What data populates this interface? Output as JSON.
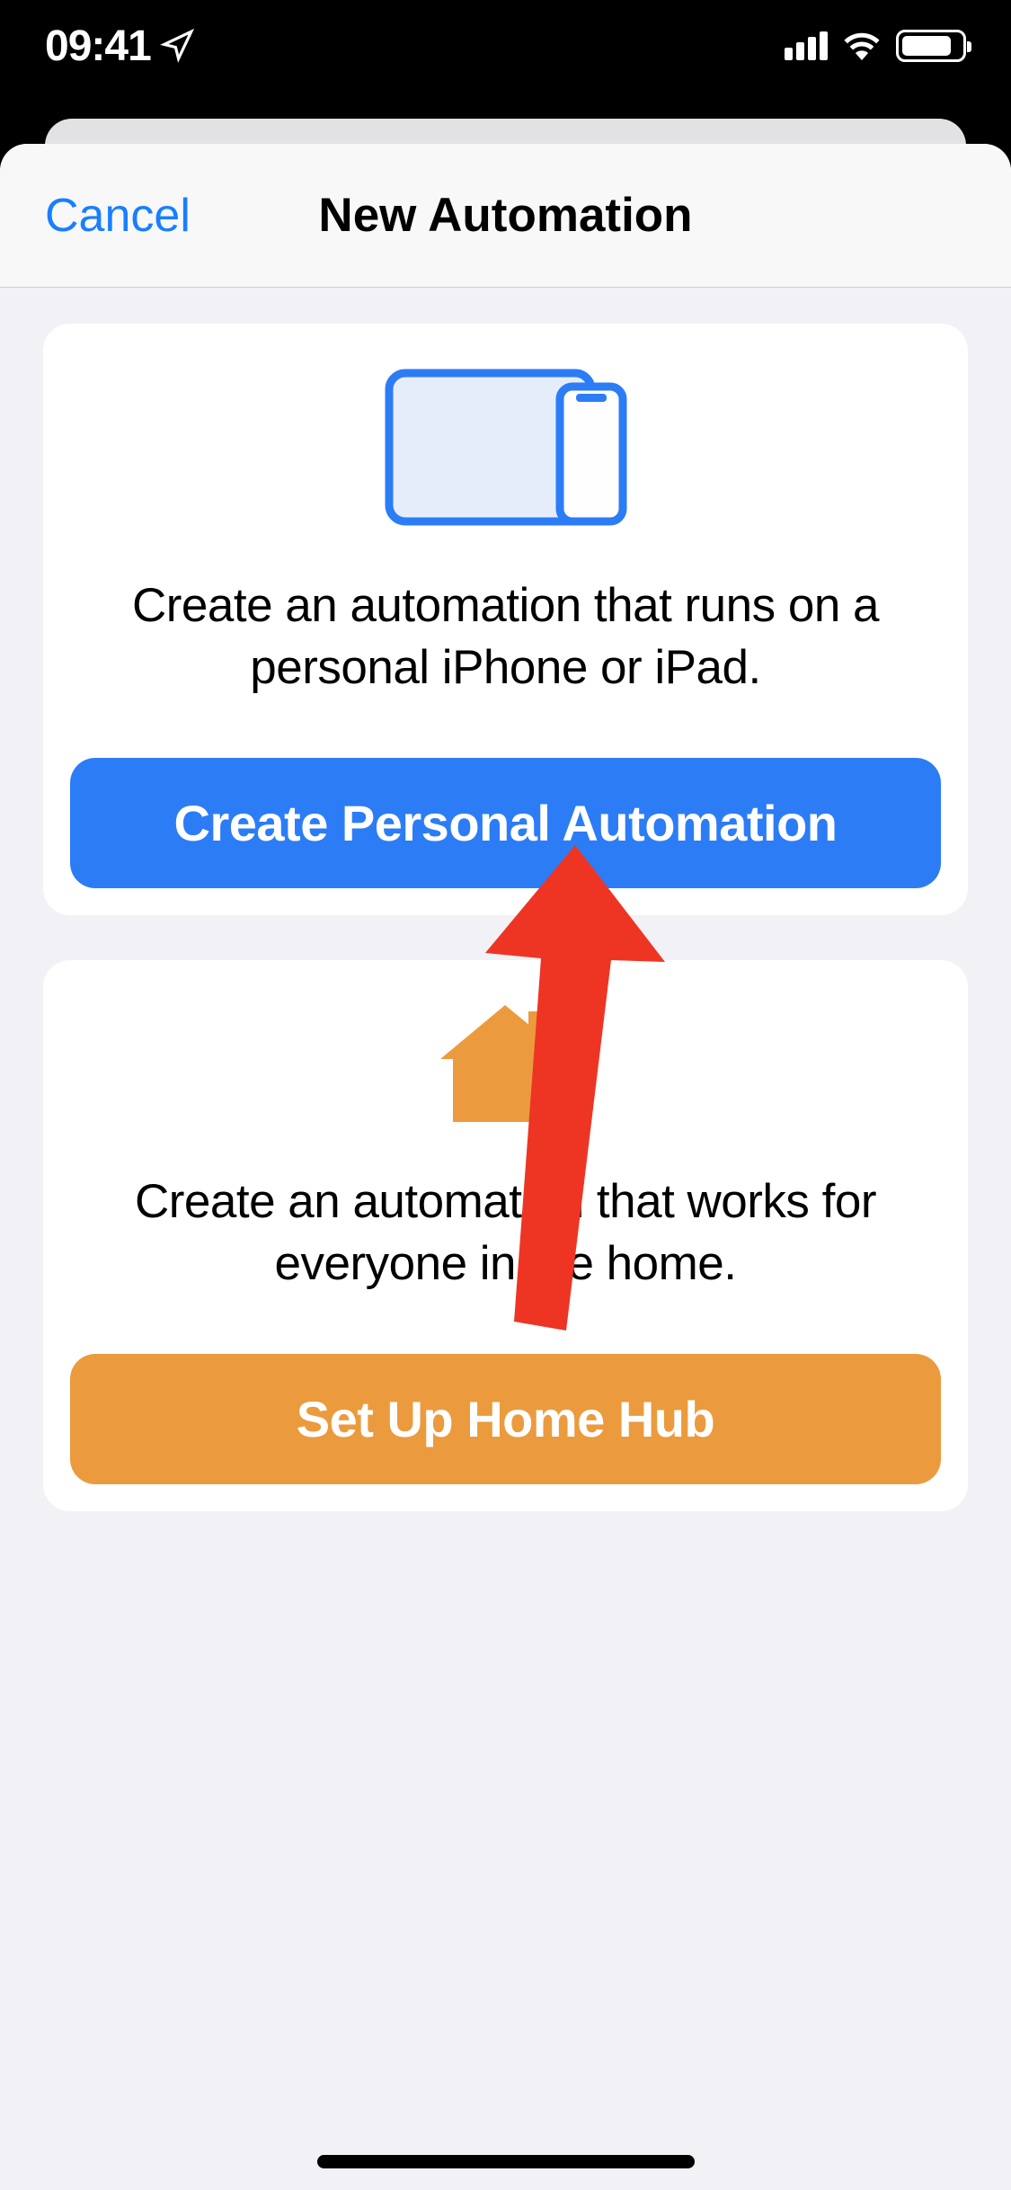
{
  "status": {
    "time": "09:41"
  },
  "nav": {
    "cancel": "Cancel",
    "title": "New Automation"
  },
  "personal": {
    "description": "Create an automation that runs on a personal iPhone or iPad.",
    "button": "Create Personal Automation"
  },
  "home": {
    "description": "Create an automation that works for everyone in the home.",
    "button": "Set Up Home Hub"
  },
  "colors": {
    "blue": "#2c7cf6",
    "orange": "#eb9b3d",
    "link": "#187fff"
  }
}
